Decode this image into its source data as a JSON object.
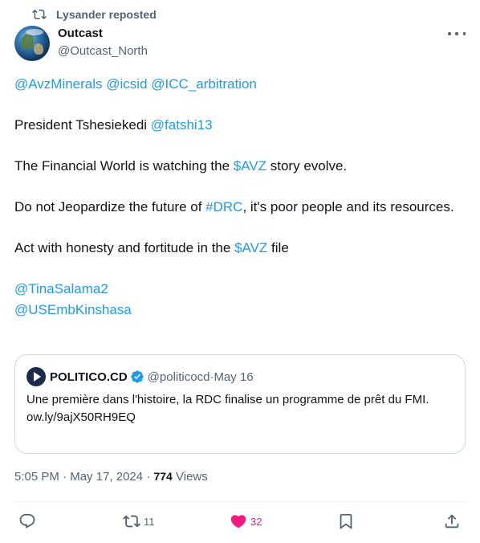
{
  "repost": {
    "text": "Lysander reposted"
  },
  "author": {
    "name": "Outcast",
    "handle": "@Outcast_North"
  },
  "tweet": {
    "line1": [
      "@AvzMinerals",
      "@icsid",
      "@ICC_arbitration"
    ],
    "line2_prefix": "President Tshesiekedi ",
    "line2_mention": "@fatshi13",
    "line3_prefix": "The Financial World is watching the ",
    "line3_cashtag": "$AVZ",
    "line3_suffix": " story evolve.",
    "line4_prefix": "Do not Jeopardize the future of ",
    "line4_hashtag": "#DRC",
    "line4_suffix": ", it's poor people and its resources.",
    "line5_prefix": "Act with honesty and fortitude in the ",
    "line5_cashtag": "$AVZ",
    "line5_suffix": " file",
    "mention_a": "@TinaSalama2",
    "mention_b": "@USEmbKinshasa"
  },
  "quote": {
    "name": "POLITICO.CD",
    "handle": "@politicocd",
    "separator": " · ",
    "date": "May 16",
    "text": "Une première dans l'histoire, la RDC finalise un programme de prêt du FMI.",
    "link": "ow.ly/9ajX50RH9EQ"
  },
  "meta": {
    "time": "5:05 PM",
    "separator": " · ",
    "date": "May 17, 2024",
    "views_count": "774",
    "views_label": "Views"
  },
  "actions": {
    "replies": "",
    "reposts": "11",
    "likes": "32"
  },
  "colors": {
    "link": "#1d9bf0",
    "like": "#f91880",
    "muted": "#536471",
    "text": "#0f1419",
    "border": "#cfd9de"
  }
}
